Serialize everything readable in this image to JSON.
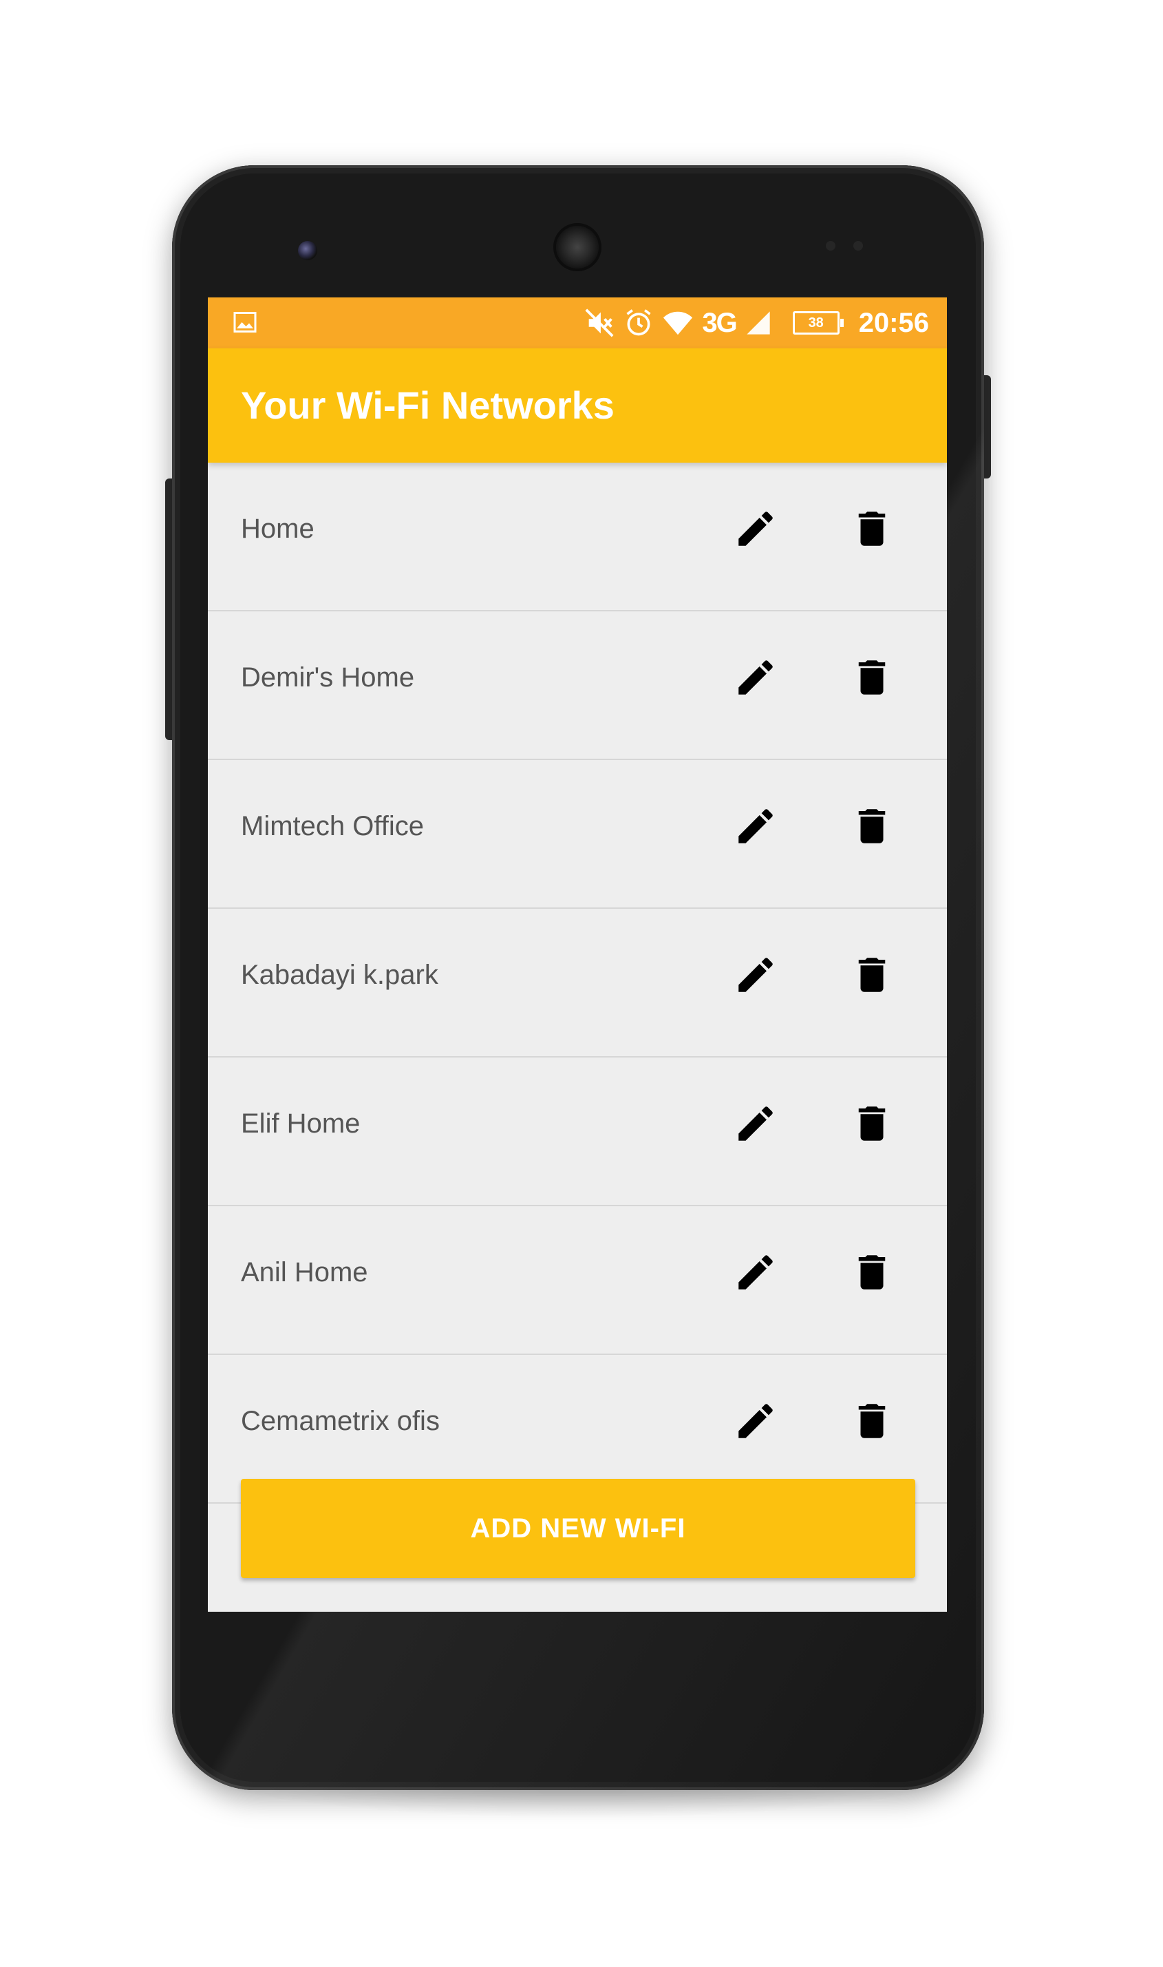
{
  "status_bar": {
    "icons": [
      "gallery-icon",
      "mute-icon",
      "alarm-icon",
      "wifi-icon",
      "signal-icon"
    ],
    "network_type": "3G",
    "battery_level": "38",
    "time": "20:56"
  },
  "app_bar": {
    "title": "Your Wi-Fi Networks"
  },
  "networks": [
    {
      "name": "Home"
    },
    {
      "name": "Demir's Home"
    },
    {
      "name": "Mimtech Office"
    },
    {
      "name": "Kabadayi k.park"
    },
    {
      "name": "Elif Home"
    },
    {
      "name": "Anil Home"
    },
    {
      "name": "Cemametrix ofis"
    }
  ],
  "row_actions": {
    "edit_icon": "pencil-icon",
    "delete_icon": "trash-icon"
  },
  "add_button": {
    "label": "ADD NEW WI-FI"
  },
  "colors": {
    "status_bar": "#f9a825",
    "app_bar": "#fcc10f",
    "accent_button": "#fcc10f",
    "list_background": "#eeeeee",
    "list_text": "#555555"
  }
}
